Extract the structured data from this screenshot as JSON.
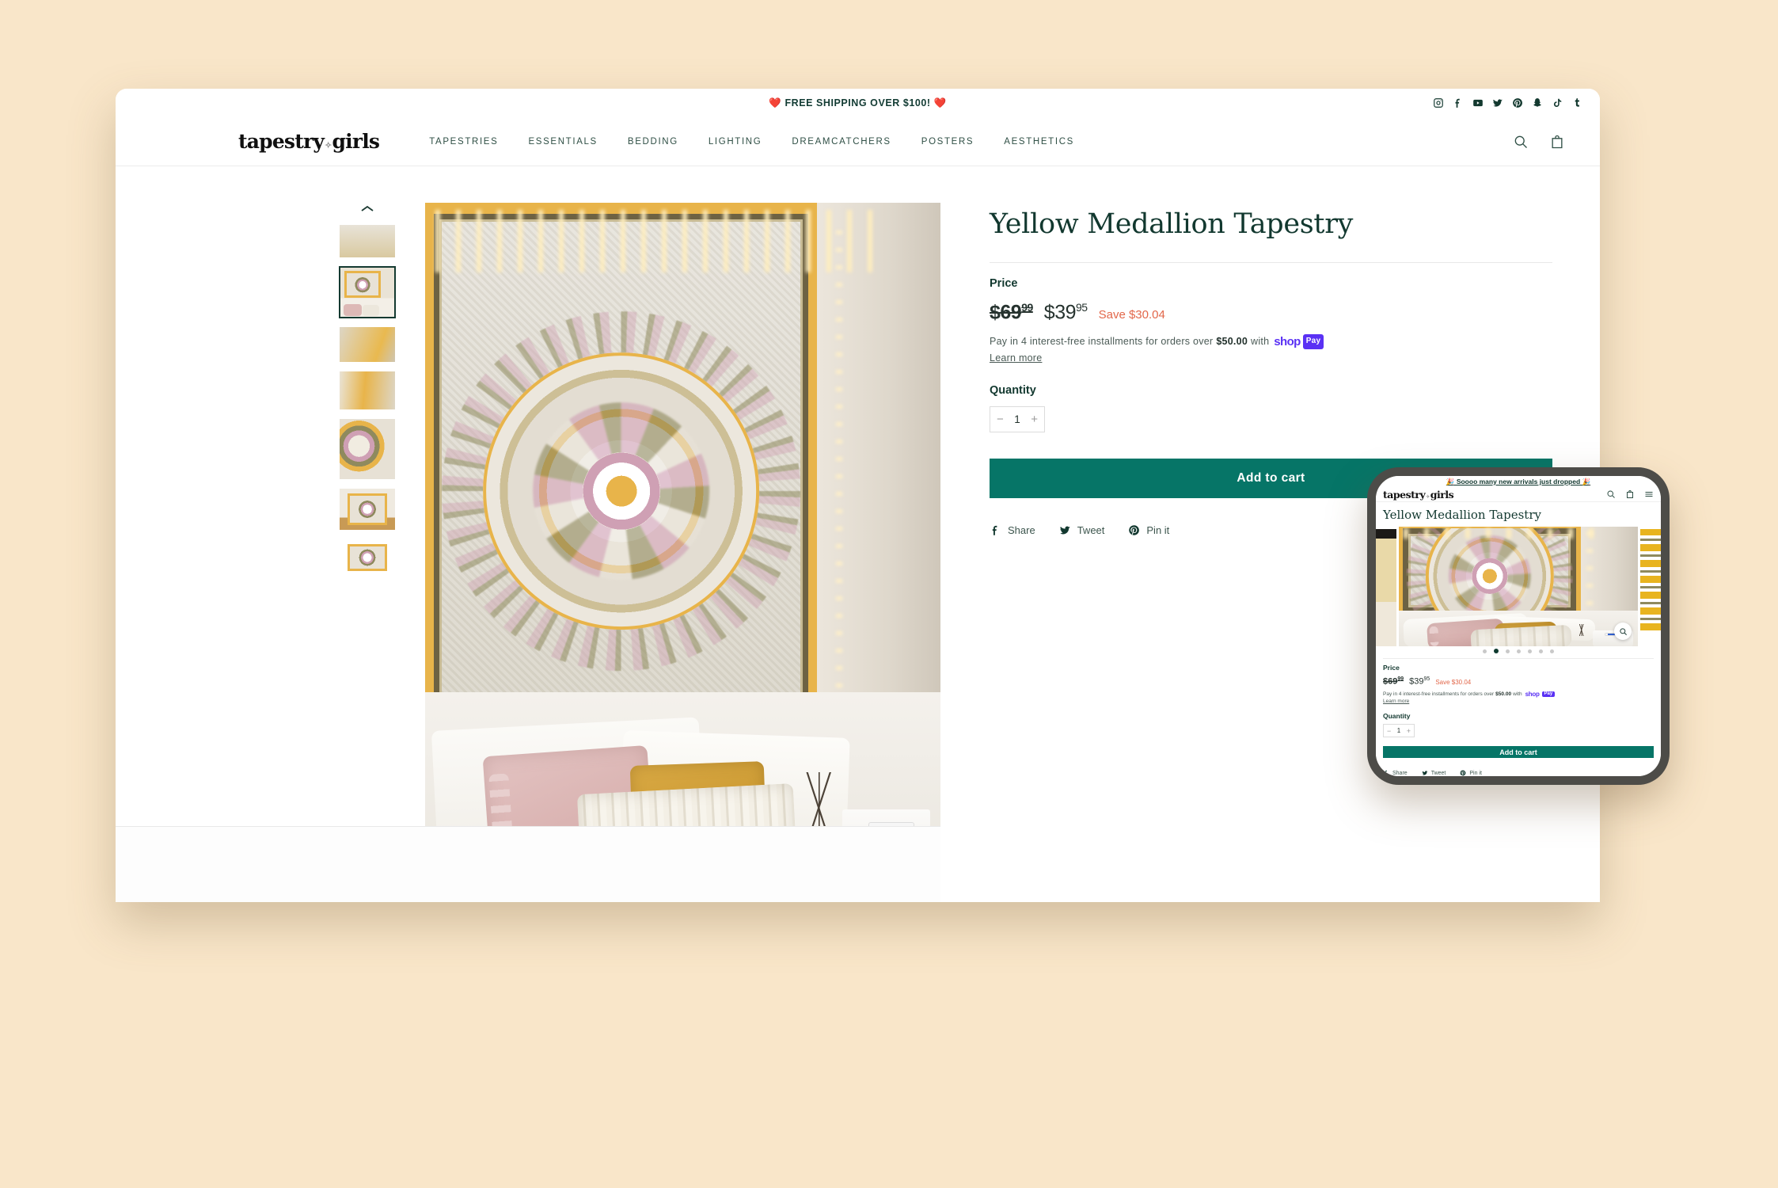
{
  "background_color": "#f9e6c9",
  "accent_color": "#067567",
  "desktop": {
    "announcement": "❤️ FREE SHIPPING OVER $100! ❤️",
    "social_icons": [
      "instagram-icon",
      "facebook-icon",
      "youtube-icon",
      "twitter-icon",
      "pinterest-icon",
      "snapchat-icon",
      "tiktok-icon",
      "tumblr-icon"
    ],
    "logo": {
      "word1": "tapestry",
      "word2": "girls"
    },
    "nav": [
      "TAPESTRIES",
      "ESSENTIALS",
      "BEDDING",
      "LIGHTING",
      "DREAMCATCHERS",
      "POSTERS",
      "AESTHETICS"
    ],
    "header_actions": [
      "search-icon",
      "cart-icon"
    ],
    "gallery": {
      "scroll_up_icon": "chevron-up-icon",
      "thumbnail_count": 7,
      "selected_thumbnail_index": 2
    },
    "product": {
      "title": "Yellow Medallion Tapestry",
      "price_label": "Price",
      "price_old": "$69",
      "price_old_cents": "99",
      "price_new": "$39",
      "price_new_cents": "95",
      "save_text": "Save $30.04",
      "installments_prefix": "Pay in 4 interest-free installments for orders over",
      "installments_amount": "$50.00",
      "installments_with": "with",
      "shop_pay_word": "shop",
      "shop_pay_badge": "Pay",
      "learn_more": "Learn more",
      "quantity_label": "Quantity",
      "quantity_minus": "−",
      "quantity_value": "1",
      "quantity_plus": "+",
      "add_to_cart": "Add to cart",
      "share": [
        {
          "label": "Share",
          "icon": "facebook-icon"
        },
        {
          "label": "Tweet",
          "icon": "twitter-icon"
        },
        {
          "label": "Pin it",
          "icon": "pinterest-icon"
        }
      ]
    }
  },
  "mobile": {
    "announcement": "🎉 Soooo many new arrivals just dropped 🎉",
    "logo": {
      "word1": "tapestry",
      "word2": "girls"
    },
    "header_actions": [
      "search-icon",
      "cart-icon",
      "menu-icon"
    ],
    "product": {
      "title": "Yellow Medallion Tapestry",
      "price_label": "Price",
      "price_old": "$69",
      "price_old_cents": "99",
      "price_new": "$39",
      "price_new_cents": "95",
      "save_text": "Save $30.04",
      "installments_prefix": "Pay in 4 interest-free installments for orders over",
      "installments_amount": "$50.00",
      "installments_with": "with",
      "shop_pay_word": "shop",
      "shop_pay_badge": "Pay",
      "learn_more": "Learn more",
      "quantity_label": "Quantity",
      "quantity_minus": "−",
      "quantity_value": "1",
      "quantity_plus": "+",
      "add_to_cart": "Add to cart",
      "share": [
        {
          "label": "Share",
          "icon": "facebook-icon"
        },
        {
          "label": "Tweet",
          "icon": "twitter-icon"
        },
        {
          "label": "Pin it",
          "icon": "pinterest-icon"
        }
      ]
    },
    "carousel": {
      "zoom_icon": "magnifier-icon",
      "dot_count": 7,
      "active_dot_index": 2
    }
  }
}
